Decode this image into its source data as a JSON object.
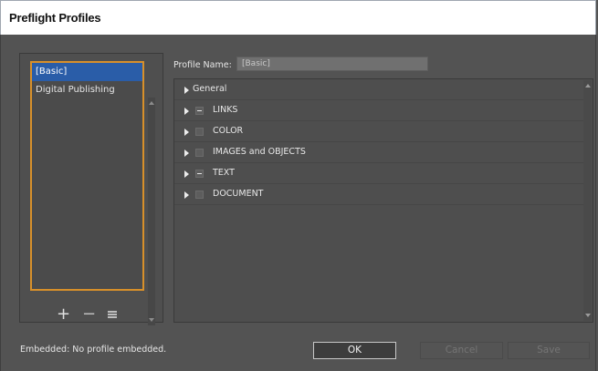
{
  "window": {
    "title": "Preflight Profiles"
  },
  "profiles": {
    "items": [
      {
        "label": "[Basic]",
        "selected": true
      },
      {
        "label": "Digital Publishing",
        "selected": false
      }
    ]
  },
  "profile_name": {
    "label": "Profile Name:",
    "value": "[Basic]"
  },
  "tree": {
    "rows": [
      {
        "label": "General",
        "checkbox": "none"
      },
      {
        "label": "LINKS",
        "checkbox": "mixed"
      },
      {
        "label": "COLOR",
        "checkbox": "unchecked"
      },
      {
        "label": "IMAGES and OBJECTS",
        "checkbox": "unchecked"
      },
      {
        "label": "TEXT",
        "checkbox": "mixed"
      },
      {
        "label": "DOCUMENT",
        "checkbox": "unchecked"
      }
    ]
  },
  "status": {
    "embedded": "Embedded: No profile embedded."
  },
  "buttons": {
    "ok": "OK",
    "cancel": "Cancel",
    "save": "Save"
  },
  "icons": {
    "add": "+",
    "remove": "−"
  },
  "colors": {
    "selection": "#2a5da8",
    "focus_border": "#d8902a",
    "background": "#535353"
  }
}
